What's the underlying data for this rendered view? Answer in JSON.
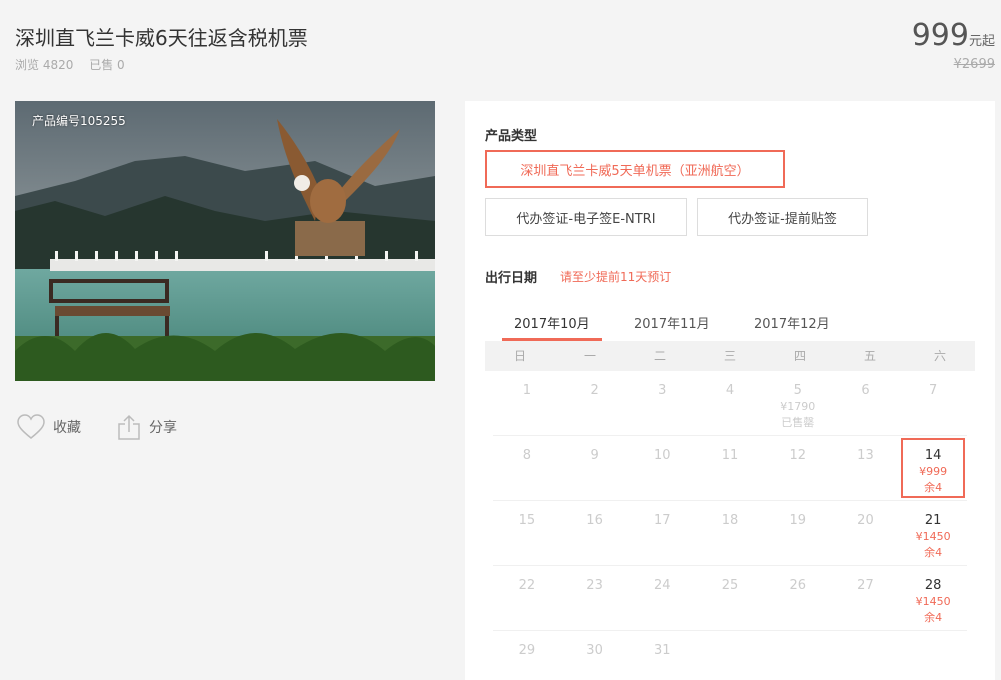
{
  "header": {
    "title": "深圳直飞兰卡威6天往返含税机票",
    "views": "浏览 4820",
    "sold": "已售 0"
  },
  "price": {
    "amount": "999",
    "unit": "元起",
    "original": "¥2699"
  },
  "photo": {
    "product_no": "产品编号105255"
  },
  "actions": {
    "favorite": "收藏",
    "share": "分享"
  },
  "product_type": {
    "label": "产品类型",
    "options": [
      "深圳直飞兰卡威5天单机票（亚洲航空）",
      "代办签证-电子签E-NTRI",
      "代办签证-提前贴签"
    ]
  },
  "travel_date": {
    "label": "出行日期",
    "hint": "请至少提前11天预订"
  },
  "months": [
    "2017年10月",
    "2017年11月",
    "2017年12月"
  ],
  "weekdays": [
    "日",
    "一",
    "二",
    "三",
    "四",
    "五",
    "六"
  ],
  "calendar": [
    [
      {
        "d": "1"
      },
      {
        "d": "2"
      },
      {
        "d": "3"
      },
      {
        "d": "4"
      },
      {
        "d": "5",
        "price": "¥1790",
        "note": "已售罄",
        "state": "soldout"
      },
      {
        "d": "6"
      },
      {
        "d": "7"
      }
    ],
    [
      {
        "d": "8"
      },
      {
        "d": "9"
      },
      {
        "d": "10"
      },
      {
        "d": "11"
      },
      {
        "d": "12"
      },
      {
        "d": "13"
      },
      {
        "d": "14",
        "price": "¥999",
        "note": "余4",
        "state": "avail sel"
      }
    ],
    [
      {
        "d": "15"
      },
      {
        "d": "16"
      },
      {
        "d": "17"
      },
      {
        "d": "18"
      },
      {
        "d": "19"
      },
      {
        "d": "20"
      },
      {
        "d": "21",
        "price": "¥1450",
        "note": "余4",
        "state": "avail"
      }
    ],
    [
      {
        "d": "22"
      },
      {
        "d": "23"
      },
      {
        "d": "24"
      },
      {
        "d": "25"
      },
      {
        "d": "26"
      },
      {
        "d": "27"
      },
      {
        "d": "28",
        "price": "¥1450",
        "note": "余4",
        "state": "avail"
      }
    ],
    [
      {
        "d": "29"
      },
      {
        "d": "30"
      },
      {
        "d": "31"
      },
      {
        "d": ""
      },
      {
        "d": ""
      },
      {
        "d": ""
      },
      {
        "d": ""
      }
    ]
  ],
  "colors": {
    "accent": "#f06a57"
  }
}
